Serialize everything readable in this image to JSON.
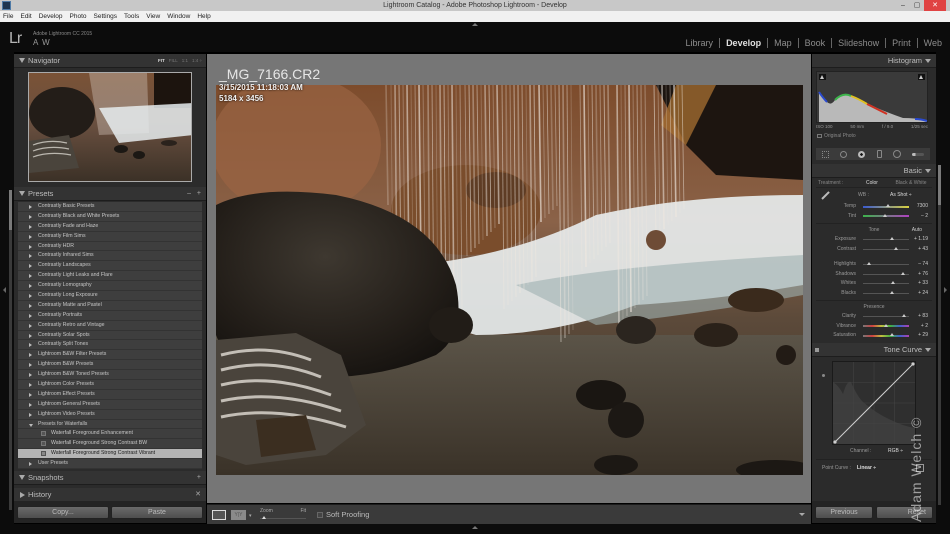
{
  "window": {
    "title": "Lightroom Catalog - Adobe Photoshop Lightroom - Develop",
    "controls": {
      "minimize": "–",
      "maximize": "▢",
      "close": "✕"
    }
  },
  "menu": [
    "File",
    "Edit",
    "Develop",
    "Photo",
    "Settings",
    "Tools",
    "View",
    "Window",
    "Help"
  ],
  "identity": {
    "logo": "Lr",
    "product": "Adobe Lightroom CC 2015",
    "user": "A W"
  },
  "modules": [
    {
      "label": "Library",
      "active": false
    },
    {
      "label": "Develop",
      "active": true
    },
    {
      "label": "Map",
      "active": false
    },
    {
      "label": "Book",
      "active": false
    },
    {
      "label": "Slideshow",
      "active": false
    },
    {
      "label": "Print",
      "active": false
    },
    {
      "label": "Web",
      "active": false
    }
  ],
  "left": {
    "navigator": {
      "title": "Navigator",
      "zoom_options": [
        "FIT",
        "FILL",
        "1:1",
        "1:4 ÷"
      ],
      "zoom_active": "FIT"
    },
    "presets": {
      "title": "Presets",
      "minus": "–",
      "plus": "+",
      "items": [
        {
          "label": "Contrastly Basic Presets",
          "type": "folder"
        },
        {
          "label": "Contrastly Black and White Presets",
          "type": "folder"
        },
        {
          "label": "Contrastly Fade and Haze",
          "type": "folder"
        },
        {
          "label": "Contrastly Film Sims",
          "type": "folder"
        },
        {
          "label": "Contrastly HDR",
          "type": "folder"
        },
        {
          "label": "Contrastly Infrared Sims",
          "type": "folder"
        },
        {
          "label": "Contrastly Landscapes",
          "type": "folder"
        },
        {
          "label": "Contrastly Light Leaks and Flare",
          "type": "folder"
        },
        {
          "label": "Contrastly Lomography",
          "type": "folder"
        },
        {
          "label": "Contrastly Long Exposure",
          "type": "folder"
        },
        {
          "label": "Contrastly Matte and Pastel",
          "type": "folder"
        },
        {
          "label": "Contrastly Portraits",
          "type": "folder"
        },
        {
          "label": "Contrastly Retro and Vintage",
          "type": "folder"
        },
        {
          "label": "Contrastly Solar Spots",
          "type": "folder"
        },
        {
          "label": "Contrastly Split Tones",
          "type": "folder"
        },
        {
          "label": "Lightroom B&W Filter Presets",
          "type": "folder"
        },
        {
          "label": "Lightroom B&W Presets",
          "type": "folder"
        },
        {
          "label": "Lightroom B&W Toned Presets",
          "type": "folder"
        },
        {
          "label": "Lightroom Color Presets",
          "type": "folder"
        },
        {
          "label": "Lightroom Effect Presets",
          "type": "folder"
        },
        {
          "label": "Lightroom General Presets",
          "type": "folder"
        },
        {
          "label": "Lightroom Video Presets",
          "type": "folder"
        },
        {
          "label": "Presets for Waterfalls",
          "type": "folder-open"
        },
        {
          "label": "Waterfall Foreground Enhancement",
          "type": "preset"
        },
        {
          "label": "Waterfall Foreground Strong Contrast BW",
          "type": "preset"
        },
        {
          "label": "Waterfall Foreground Strong Contrast Vibrant",
          "type": "preset-selected"
        },
        {
          "label": "User Presets",
          "type": "folder"
        }
      ]
    },
    "snapshots": {
      "title": "Snapshots",
      "action": "+"
    },
    "history": {
      "title": "History",
      "action": "✕"
    },
    "copy_label": "Copy...",
    "paste_label": "Paste"
  },
  "center": {
    "filename": "_MG_7166.CR2",
    "datetime": "3/15/2015 11:18:03 AM",
    "dimensions": "5184 x 3456"
  },
  "toolbar": {
    "compare_label": "Y|Y",
    "zoom_label": "Zoom",
    "zoom_fit": "Fit",
    "soft_proofing_label": "Soft Proofing",
    "soft_proofing_checked": false
  },
  "right": {
    "histogram": {
      "title": "Histogram",
      "iso": "ISO 100",
      "focal": "50 mm",
      "aperture": "f / 9.0",
      "shutter": "1/25 sec",
      "original_photo": "Original Photo"
    },
    "tools": [
      "crop-overlay",
      "spot-removal",
      "red-eye",
      "graduated-filter",
      "radial-filter",
      "adjustment-brush"
    ],
    "basic": {
      "title": "Basic",
      "treatment_label": "Treatment :",
      "treatment_color": "Color",
      "treatment_bw": "Black & White",
      "wb_label": "WB :",
      "wb_value": "As Shot ÷",
      "temp": {
        "label": "Temp",
        "value": "7300",
        "position": 0.55
      },
      "tint": {
        "label": "Tint",
        "value": "– 2",
        "position": 0.48
      },
      "tone_label": "Tone",
      "auto_label": "Auto",
      "exposure": {
        "label": "Exposure",
        "value": "+ 1.19",
        "position": 0.62
      },
      "contrast": {
        "label": "Contrast",
        "value": "+ 43",
        "position": 0.71
      },
      "highlights": {
        "label": "Highlights",
        "value": "– 74",
        "position": 0.13
      },
      "shadows": {
        "label": "Shadows",
        "value": "+ 76",
        "position": 0.88
      },
      "whites": {
        "label": "Whites",
        "value": "+ 33",
        "position": 0.66
      },
      "blacks": {
        "label": "Blacks",
        "value": "+ 24",
        "position": 0.62
      },
      "presence_label": "Presence",
      "clarity": {
        "label": "Clarity",
        "value": "+ 83",
        "position": 0.9
      },
      "vibrance": {
        "label": "Vibrance",
        "value": "+ 2",
        "position": 0.51
      },
      "saturation": {
        "label": "Saturation",
        "value": "+ 29",
        "position": 0.63
      }
    },
    "tone_curve": {
      "title": "Tone Curve",
      "channel_label": "Channel :",
      "channel_value": "RGB ÷",
      "point_curve_label": "Point Curve :",
      "point_curve_value": "Linear ÷"
    },
    "previous_label": "Previous",
    "reset_label": "Reset"
  },
  "watermark": "Adam Welch ©"
}
